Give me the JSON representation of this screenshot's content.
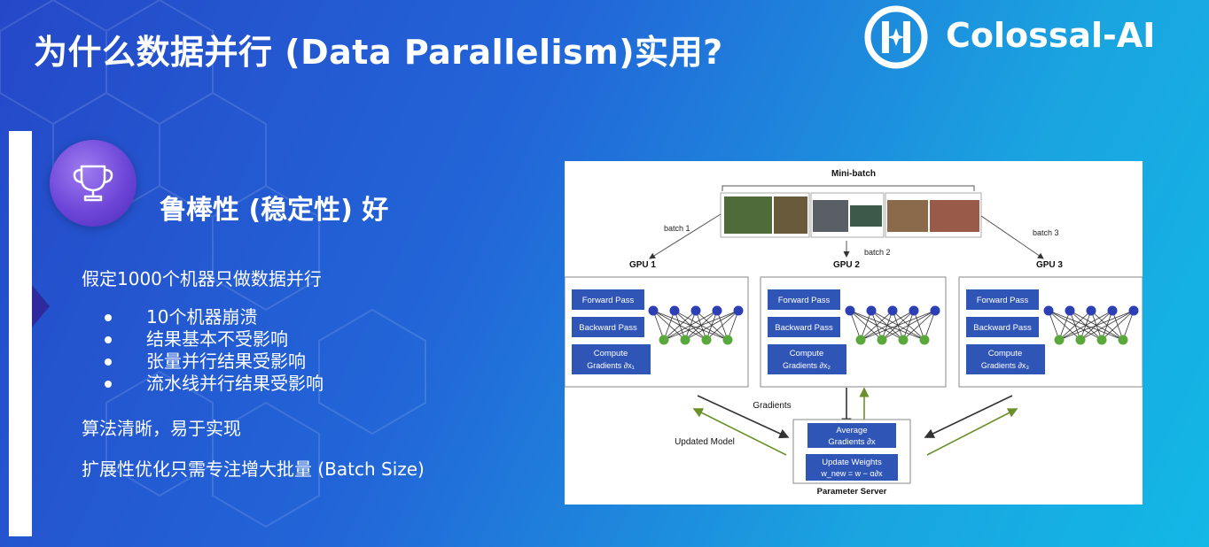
{
  "slide": {
    "title": "为什么数据并行 (Data Parallelism)实用?",
    "logo_text": "Colossal-AI",
    "section_heading": "鲁棒性 (稳定性) 好",
    "premise": "假定1000个机器只做数据并行",
    "bullets": [
      "10个机器崩溃",
      "结果基本不受影响",
      "张量并行结果受影响",
      "流水线并行结果受影响"
    ],
    "point2": "算法清晰，易于实现",
    "point3": "扩展性优化只需专注增大批量 (Batch Size)"
  },
  "diagram": {
    "minibatch_label": "Mini-batch",
    "batch_labels": [
      "batch 1",
      "batch 2",
      "batch 3"
    ],
    "gpu_labels": [
      "GPU 1",
      "GPU 2",
      "GPU 3"
    ],
    "forward": "Forward Pass",
    "backward": "Backward Pass",
    "compute_line1": "Compute",
    "compute_line2": [
      "Gradients ∂x₁",
      "Gradients ∂x₂",
      "Gradients ∂x₃"
    ],
    "gradients_label": "Gradients",
    "updated_model_label": "Updated Model",
    "average_line1": "Average",
    "average_line2": "Gradients ∂x",
    "update_line1": "Update Weights",
    "update_line2": "w_new = w − α∂x",
    "server_label": "Parameter Server"
  },
  "colors": {
    "bg_start": "#2548c8",
    "bg_end": "#12b8e6",
    "box_blue": "#2f55b6",
    "node_blue": "#2d3fb5",
    "node_green": "#5aa83c",
    "trophy": "#6d46d8"
  },
  "icons": [
    "trophy-icon",
    "colossal-ai-logo-icon",
    "indicator-arrow-icon"
  ]
}
